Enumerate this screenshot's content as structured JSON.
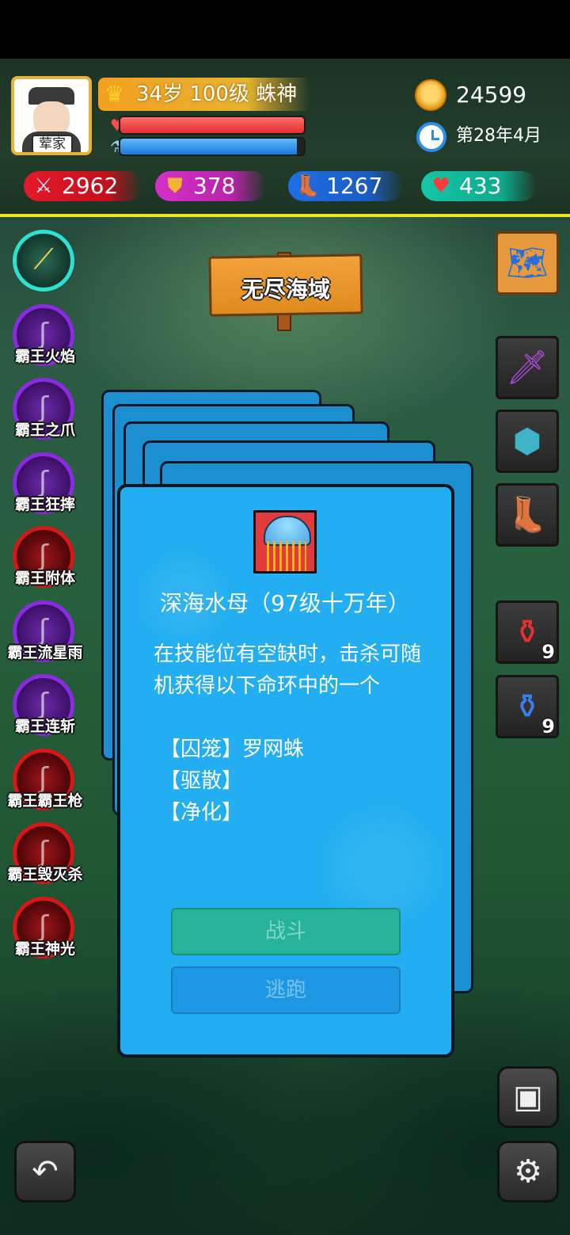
{
  "player": {
    "avatar_name": "荤家",
    "level_text": "34岁 100级 蛛神",
    "hp_fraction": 1.0,
    "mp_fraction": 0.96,
    "gold": "24599",
    "date": "第28年4月"
  },
  "stats": {
    "attack": "2962",
    "defense": "378",
    "speed": "1267",
    "health": "433"
  },
  "location": "无尽海域",
  "skills": [
    {
      "label": "",
      "color": "cyan"
    },
    {
      "label": "霸王火焰",
      "color": "purple"
    },
    {
      "label": "霸王之爪",
      "color": "purple"
    },
    {
      "label": "霸王狂摔",
      "color": "purple"
    },
    {
      "label": "霸王附体",
      "color": "red"
    },
    {
      "label": "霸王流星雨",
      "color": "purple"
    },
    {
      "label": "霸王连斩",
      "color": "purple"
    },
    {
      "label": "霸王霸王枪",
      "color": "red"
    },
    {
      "label": "霸王毁灭杀",
      "color": "red"
    },
    {
      "label": "霸王神光",
      "color": "red"
    }
  ],
  "inventory": {
    "red_potion_count": "9",
    "blue_potion_count": "9"
  },
  "encounter": {
    "monster_name": "深海水母（97级十万年）",
    "description": "在技能位有空缺时，击杀可随机获得以下命环中的一个",
    "rings": [
      "【囚笼】罗网蛛",
      "【驱散】",
      "【净化】"
    ],
    "fight_label": "战斗",
    "flee_label": "逃跑"
  },
  "icons": {
    "map": "map-scroll-icon",
    "weapon": "purple-sword-icon",
    "armor": "spiked-shell-armor-icon",
    "boots": "boots-icon",
    "save": "save-icon",
    "settings": "gear-icon",
    "back": "back-arrow-icon"
  }
}
